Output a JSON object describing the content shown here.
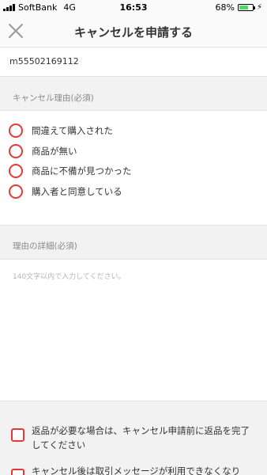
{
  "status_bar": {
    "carrier": "SoftBank",
    "network": "4G",
    "time": "16:53",
    "battery_percent": "68%",
    "battery_level": 0.68,
    "battery_color": "#4cd964"
  },
  "nav": {
    "close_icon": "close-icon",
    "title": "キャンセルを申請する"
  },
  "order": {
    "id": "m55502169112"
  },
  "reason_section": {
    "label": "キャンセル理由(必須)",
    "options": [
      {
        "label": "間違えて購入された",
        "selected": false
      },
      {
        "label": "商品が無い",
        "selected": false
      },
      {
        "label": "商品に不備が見つかった",
        "selected": false
      },
      {
        "label": "購入者と同意している",
        "selected": false
      }
    ]
  },
  "details_section": {
    "label": "理由の詳細(必須)",
    "placeholder": "140文字以内で入力してください。",
    "value": ""
  },
  "notices": [
    {
      "text": "返品が必要な場合は、キャンセル申請前に返品を完了してください",
      "checked": false
    },
    {
      "text": "キャンセル後は取引メッセージが利用できなくなり",
      "checked": false
    }
  ],
  "colors": {
    "accent": "#e53935",
    "background": "#f2f2f2"
  }
}
